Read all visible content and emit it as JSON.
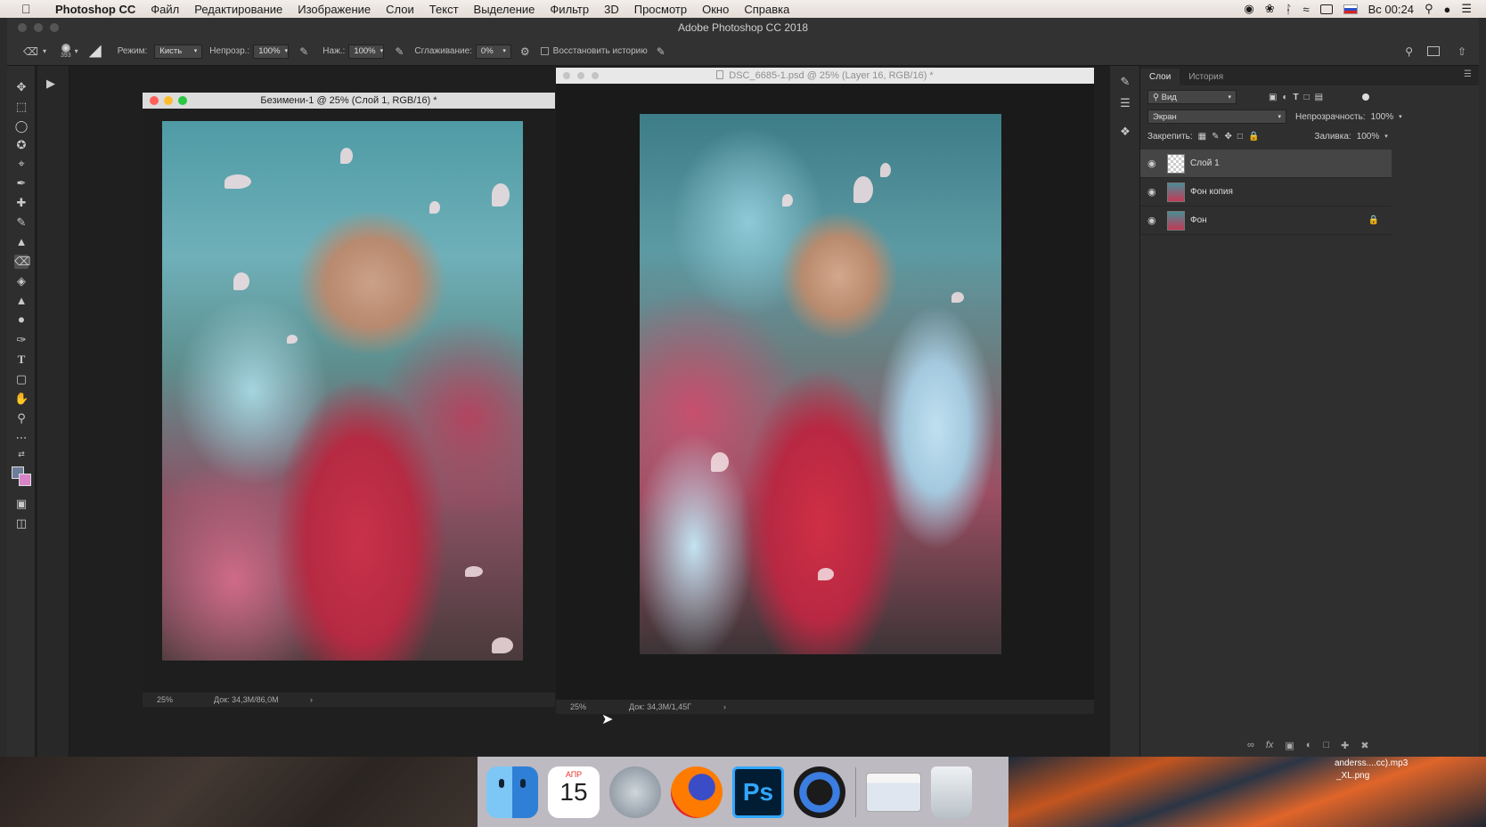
{
  "menubar": {
    "app": "Photoshop CC",
    "items": [
      "Файл",
      "Редактирование",
      "Изображение",
      "Слои",
      "Текст",
      "Выделение",
      "Фильтр",
      "3D",
      "Просмотр",
      "Окно",
      "Справка"
    ],
    "clock": "Вс 00:24"
  },
  "window": {
    "title": "Adobe Photoshop CC 2018"
  },
  "options": {
    "brush_size": "393",
    "mode_label": "Режим:",
    "mode_value": "Кисть",
    "opacity_label": "Непрозр.:",
    "opacity_value": "100%",
    "pressure_label": "Наж.:",
    "pressure_value": "100%",
    "smoothing_label": "Сглаживание:",
    "smoothing_value": "0%",
    "restore_history": "Восстановить историю"
  },
  "doc1": {
    "title": "Безимени-1 @ 25% (Слой 1, RGB/16) *",
    "zoom": "25%",
    "info": "Док: 34,3M/86,0M"
  },
  "doc2": {
    "title": "DSC_6685-1.psd @ 25% (Layer 16, RGB/16) *",
    "zoom": "25%",
    "info": "Док: 34,3M/1,45Г"
  },
  "panel": {
    "tab_layers": "Слои",
    "tab_history": "История",
    "filter_kind": "Вид",
    "blend_mode": "Экран",
    "opacity_label": "Непрозрачность:",
    "opacity_value": "100%",
    "lock_label": "Закрепить:",
    "fill_label": "Заливка:",
    "fill_value": "100%",
    "layers": [
      {
        "name": "Слой 1"
      },
      {
        "name": "Фон копия"
      },
      {
        "name": "Фон"
      }
    ]
  },
  "dock": {
    "calendar_month": "АПР",
    "calendar_day": "15"
  },
  "desktop": {
    "file1": "_XL.png",
    "file2": "anderss....cc).mp3"
  }
}
